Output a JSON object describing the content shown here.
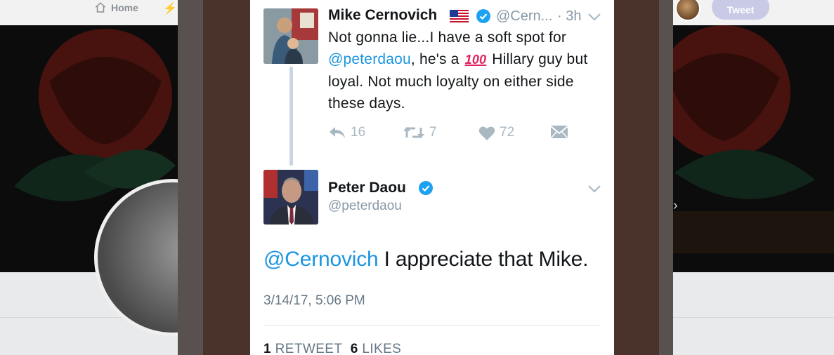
{
  "background": {
    "nav_home_label": "Home",
    "tweet_button_label": "Tweet"
  },
  "tweet_parent": {
    "author_name": "Mike Cernovich",
    "author_handle": "@Cern...",
    "time_ago": "· 3h",
    "text_line1": "Not gonna lie...I have a soft spot for",
    "mention": "@peterdaou",
    "text_after_mention": ", he's a",
    "emoji_label": "100",
    "text_rest": "Hillary guy but loyal.  Not much loyalty on either side these days.",
    "replies": "16",
    "retweets": "7",
    "likes": "72"
  },
  "tweet_reply": {
    "author_name": "Peter Daou",
    "author_handle": "@peterdaou",
    "mention": "@Cernovich",
    "text": " I appreciate that Mike.",
    "timestamp": "3/14/17, 5:06 PM",
    "retweet_count": "1",
    "retweet_label": "RETWEET",
    "like_count": "6",
    "like_label": "LIKES"
  },
  "colors": {
    "link_blue": "#1b95e0",
    "muted_gray": "#8899a6",
    "verified_blue": "#1da1f2",
    "action_gray": "#aab8c2"
  },
  "icons": [
    "home-icon",
    "bolt-icon",
    "us-flag-icon",
    "verified-badge-icon",
    "chevron-down-icon",
    "reply-icon",
    "retweet-icon",
    "heart-icon",
    "direct-message-icon",
    "next-arrow-icon"
  ]
}
